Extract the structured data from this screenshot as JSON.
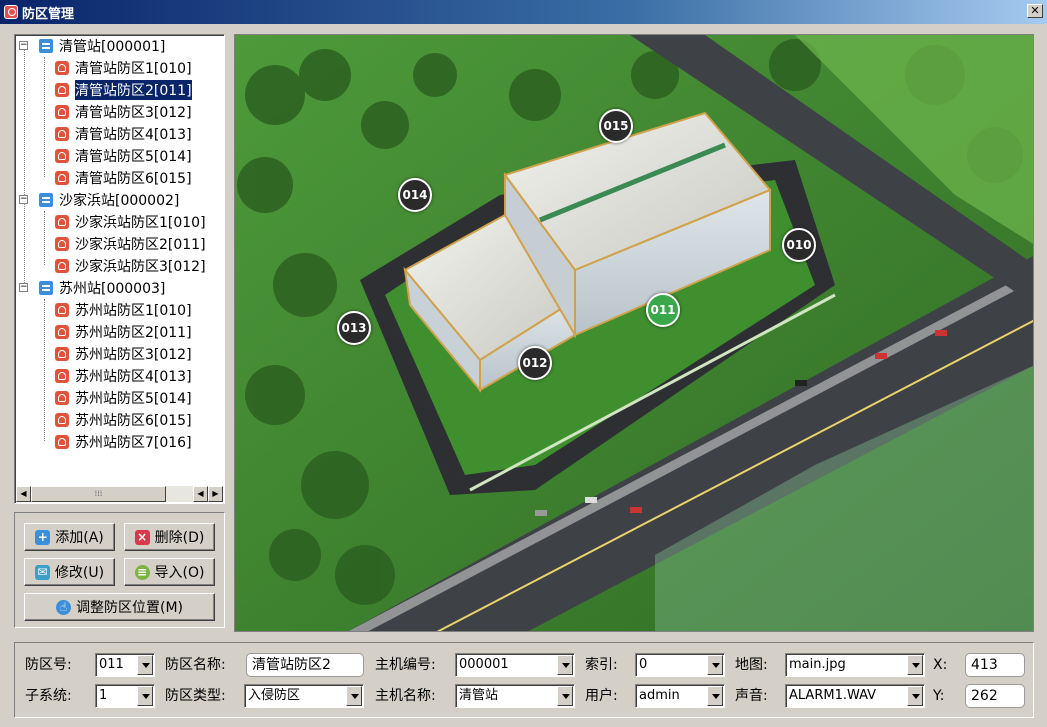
{
  "window": {
    "title": "防区管理"
  },
  "tree": {
    "stations": [
      {
        "label": "清管站[000001]",
        "zones": [
          "清管站防区1[010]",
          "清管站防区2[011]",
          "清管站防区3[012]",
          "清管站防区4[013]",
          "清管站防区5[014]",
          "清管站防区6[015]"
        ]
      },
      {
        "label": "沙家浜站[000002]",
        "zones": [
          "沙家浜站防区1[010]",
          "沙家浜站防区2[011]",
          "沙家浜站防区3[012]"
        ]
      },
      {
        "label": "苏州站[000003]",
        "zones": [
          "苏州站防区1[010]",
          "苏州站防区2[011]",
          "苏州站防区3[012]",
          "苏州站防区4[013]",
          "苏州站防区5[014]",
          "苏州站防区6[015]",
          "苏州站防区7[016]"
        ]
      }
    ],
    "selected": "清管站防区2[011]"
  },
  "buttons": {
    "add": "添加(A)",
    "delete": "删除(D)",
    "modify": "修改(U)",
    "import": "导入(O)",
    "adjust_position": "调整防区位置(M)"
  },
  "map": {
    "markers": [
      {
        "label": "015",
        "active": false
      },
      {
        "label": "014",
        "active": false
      },
      {
        "label": "010",
        "active": false
      },
      {
        "label": "011",
        "active": true
      },
      {
        "label": "013",
        "active": false
      },
      {
        "label": "012",
        "active": false
      }
    ]
  },
  "form": {
    "zone_no_label": "防区号:",
    "zone_no": "011",
    "zone_name_label": "防区名称:",
    "zone_name": "清管站防区2",
    "host_no_label": "主机编号:",
    "host_no": "000001",
    "index_label": "索引:",
    "index": "0",
    "map_label": "地图:",
    "map_file": "main.jpg",
    "x_label": "X:",
    "x_value": "413",
    "subsystem_label": "子系统:",
    "subsystem": "1",
    "zone_type_label": "防区类型:",
    "zone_type": "入侵防区",
    "host_name_label": "主机名称:",
    "host_name": "清管站",
    "user_label": "用户:",
    "user": "admin",
    "sound_label": "声音:",
    "sound": "ALARM1.WAV",
    "y_label": "Y:",
    "y_value": "262"
  },
  "colors": {
    "titlebar": "#0a246a",
    "selection": "#0a246a",
    "active_marker": "#3aa84a",
    "marker": "#2a2a2a"
  }
}
